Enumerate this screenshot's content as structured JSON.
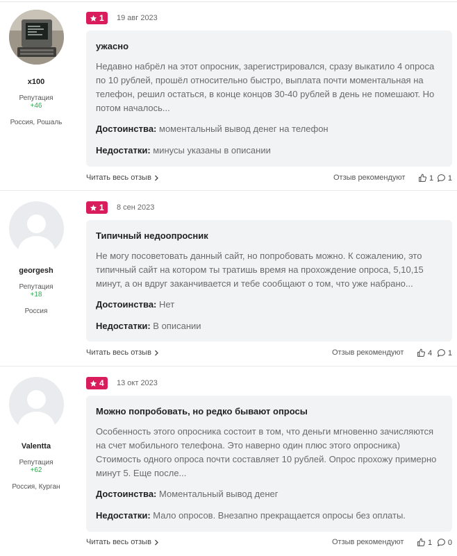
{
  "reviews": [
    {
      "author": {
        "name": "x100",
        "rep_label": "Репутация",
        "rep_value": "+46",
        "location": "Россия, Рошаль",
        "avatar": "computer-photo-avatar"
      },
      "rating": "1",
      "date": "19 авг 2023",
      "title": "ужасно",
      "excerpt": "Недавно набрёл на этот опросник, зарегистрировался, сразу выкатило 4 опроса по 10 рублей, прошёл относительно быстро, выплата почти моментальная на телефон, решил остаться, в конце концов 30-40 рублей в день не помешают. Но потом началось...",
      "pros_label": "Достоинства:",
      "pros": "моментальный вывод денег на телефон",
      "cons_label": "Недостатки:",
      "cons": "минусы указаны в описании",
      "read_more": "Читать весь отзыв",
      "recommend": "Отзыв рекомендуют",
      "likes": "1",
      "comments": "1"
    },
    {
      "author": {
        "name": "georgesh",
        "rep_label": "Репутация",
        "rep_value": "+18",
        "location": "Россия",
        "avatar": "default-avatar"
      },
      "rating": "1",
      "date": "8 сен 2023",
      "title": "Типичный недоопросник",
      "excerpt": "Не могу посоветовать данный сайт, но попробовать можно. К сожалению, это типичный сайт на котором ты тратишь время на прохождение опроса, 5,10,15 минут, а он вдруг заканчивается и тебе сообщают о том, что уже набрано...",
      "pros_label": "Достоинства:",
      "pros": "Нет",
      "cons_label": "Недостатки:",
      "cons": "В описании",
      "read_more": "Читать весь отзыв",
      "recommend": "Отзыв рекомендуют",
      "likes": "4",
      "comments": "1"
    },
    {
      "author": {
        "name": "Valentta",
        "rep_label": "Репутация",
        "rep_value": "+62",
        "location": "Россия, Курган",
        "avatar": "default-avatar"
      },
      "rating": "4",
      "date": "13 окт 2023",
      "title": "Можно попробовать, но редко бывают опросы",
      "excerpt": "Особенность этого опросника состоит в том, что деньги мгновенно зачисляются на счет мобильного телефона. Это наверно один плюс этого опросника) Стоимость одного опроса почти составляет 10 рублей. Опрос прохожу примерно минут 5. Еще после...",
      "pros_label": "Достоинства:",
      "pros": "Моментальный вывод денег",
      "cons_label": "Недостатки:",
      "cons": "Мало опросов. Внезапно прекращается опросы без оплаты.",
      "read_more": "Читать весь отзыв",
      "recommend": "Отзыв рекомендуют",
      "likes": "1",
      "comments": "0"
    }
  ],
  "colors": {
    "rating_badge": "#d91c5c",
    "reputation": "#2fa84f",
    "card_bg": "#f2f3f5"
  },
  "icons": {
    "star": "star-icon",
    "chevron": "chevron-right-icon",
    "thumb": "thumbs-up-icon",
    "comment": "comment-icon"
  }
}
